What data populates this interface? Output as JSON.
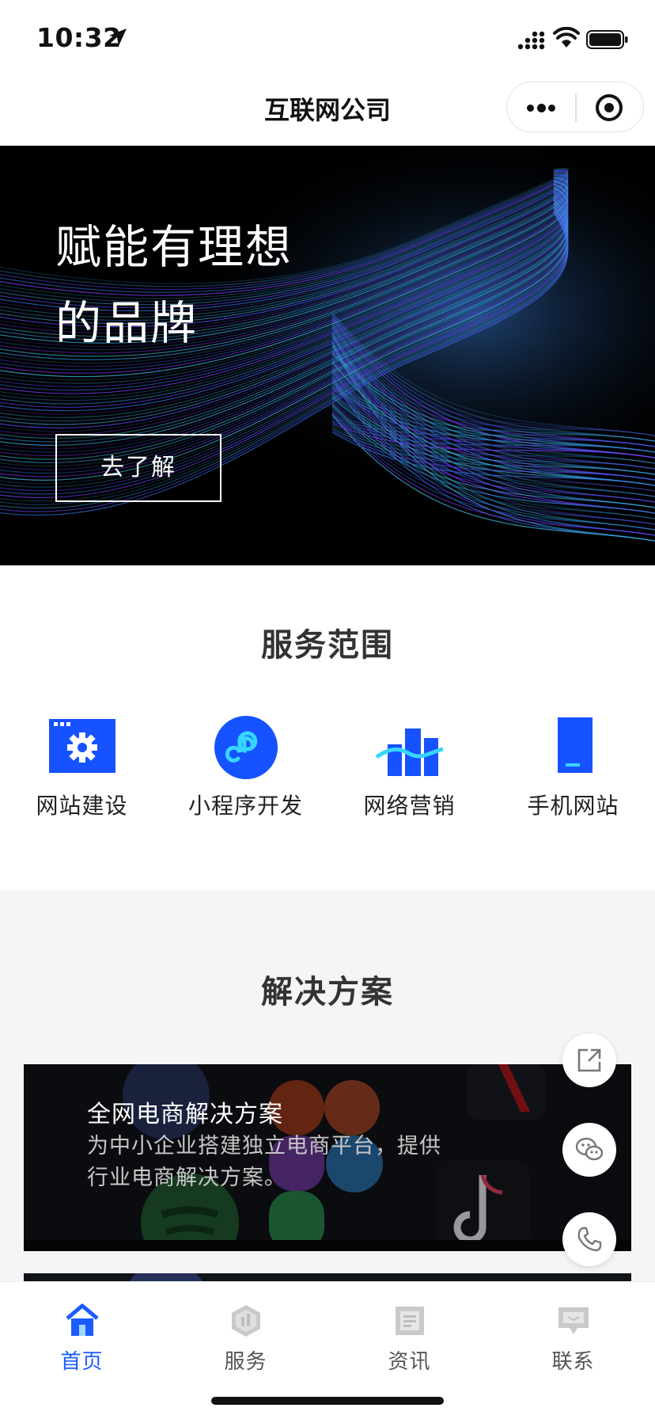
{
  "status_bar": {
    "time": "10:32",
    "icons": [
      "location-arrow-icon",
      "cellular-signal-icon",
      "wifi-icon",
      "battery-icon"
    ]
  },
  "nav": {
    "title": "互联网公司",
    "capsule": [
      "more-icon",
      "close-target-icon"
    ]
  },
  "banner": {
    "title_line1": "赋能有理想",
    "title_line2": "的品牌",
    "button_label": "去了解"
  },
  "services": {
    "title": "服务范围",
    "items": [
      {
        "label": "网站建设",
        "icon": "website-gear-icon"
      },
      {
        "label": "小程序开发",
        "icon": "mini-program-icon"
      },
      {
        "label": "网络营销",
        "icon": "marketing-chart-icon"
      },
      {
        "label": "手机网站",
        "icon": "mobile-phone-icon"
      }
    ]
  },
  "solutions": {
    "title": "解决方案",
    "cards": [
      {
        "title": "全网电商解决方案",
        "description": "为中小企业搭建独立电商平台，提供行业电商解决方案。"
      }
    ]
  },
  "floating_actions": [
    "share-icon",
    "wechat-icon",
    "phone-icon"
  ],
  "tab_bar": {
    "tabs": [
      {
        "label": "首页",
        "icon": "home-icon",
        "active": true
      },
      {
        "label": "服务",
        "icon": "service-hexagon-icon",
        "active": false
      },
      {
        "label": "资讯",
        "icon": "news-icon",
        "active": false
      },
      {
        "label": "联系",
        "icon": "contact-chat-icon",
        "active": false
      }
    ]
  },
  "colors": {
    "accent": "#1b5cff",
    "icon_cyan": "#37d6ff",
    "banner_bg": "#000000",
    "solutions_bg": "#f5f5f5"
  }
}
